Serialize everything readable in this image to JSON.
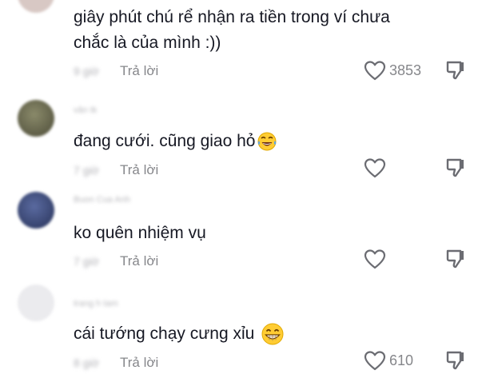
{
  "comments": [
    {
      "username": "",
      "text_lines": [
        "giây phút chú rể nhận ra tiền trong ví chưa",
        "chắc là của mình :))"
      ],
      "time": "9 giờ",
      "reply_label": "Trả lời",
      "like_count": "3853",
      "avatar_color": "#d8c8c4",
      "emoji": ""
    },
    {
      "username": "vân tk",
      "text_lines": [
        "đang cưới. cũng giao hỏ"
      ],
      "time": "7 giờ",
      "reply_label": "Trả lời",
      "like_count": "",
      "avatar_color": "#6b6a4f",
      "emoji": "face-with-tears-of-joy"
    },
    {
      "username": "Buon Cua Anh",
      "text_lines": [
        "ko quên nhiệm vụ"
      ],
      "time": "7 giờ",
      "reply_label": "Trả lời",
      "like_count": "",
      "avatar_color": "#3c4a78",
      "emoji": ""
    },
    {
      "username": "trang h tam",
      "text_lines": [
        "cái tướng chạy cưng xỉu"
      ],
      "time": "8 giờ",
      "reply_label": "Trả lời",
      "like_count": "610",
      "avatar_color": "#e9e9ec",
      "emoji": "grinning-face"
    }
  ]
}
